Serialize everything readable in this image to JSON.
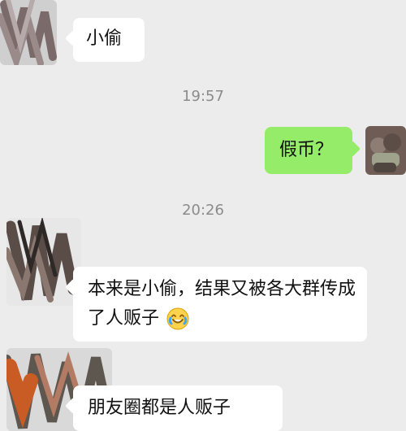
{
  "messages": [
    {
      "side": "in",
      "text": "小偷"
    },
    {
      "side": "out",
      "text": "假币？"
    },
    {
      "side": "in",
      "text": "本来是小偷，结果又被各大群传成了人贩子"
    },
    {
      "side": "in",
      "text": "朋友圈都是人贩子"
    }
  ],
  "timestamps": [
    "19:57",
    "20:26"
  ],
  "icons": {
    "laugh_cry": "laugh-cry-icon"
  },
  "colors": {
    "background": "#ececec",
    "incoming_bubble": "#ffffff",
    "outgoing_bubble": "#95ec69",
    "timestamp_text": "#8b8b8b"
  }
}
